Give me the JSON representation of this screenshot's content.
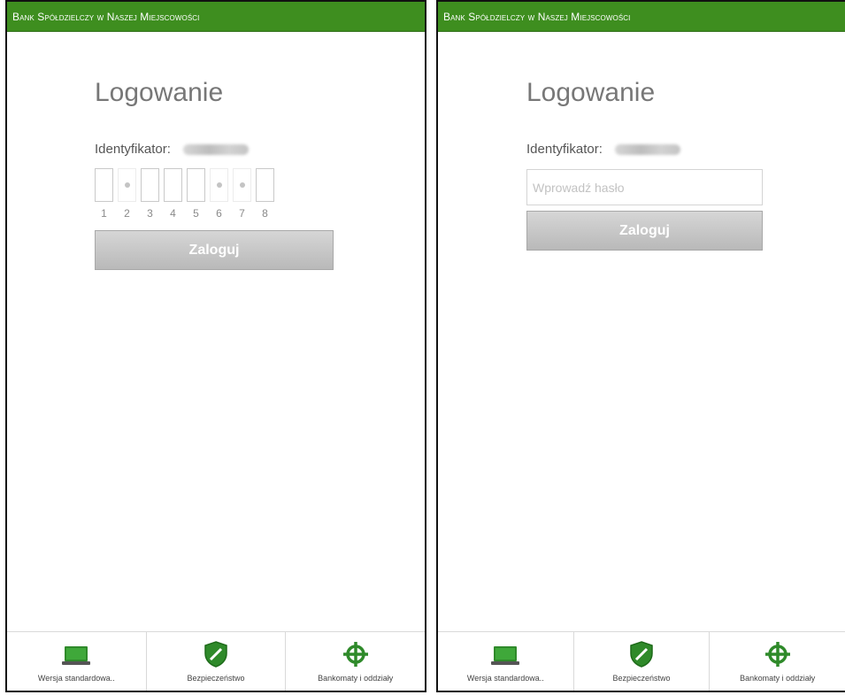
{
  "colors": {
    "brand_green": "#3e8e1f",
    "button_gray": "#c7c7c7",
    "title_gray": "#777777"
  },
  "left": {
    "header": "Bank Spółdzielczy w Naszej Miejscowości",
    "title": "Logowanie",
    "id_label": "Identyfikator:",
    "char_boxes": [
      {
        "num": "1",
        "active": true
      },
      {
        "num": "2",
        "active": false
      },
      {
        "num": "3",
        "active": true
      },
      {
        "num": "4",
        "active": true
      },
      {
        "num": "5",
        "active": true
      },
      {
        "num": "6",
        "active": false
      },
      {
        "num": "7",
        "active": false
      },
      {
        "num": "8",
        "active": true
      }
    ],
    "login_label": "Zaloguj",
    "nav": [
      {
        "label": "Wersja standardowa..",
        "icon": "laptop-icon"
      },
      {
        "label": "Bezpieczeństwo",
        "icon": "shield-icon"
      },
      {
        "label": "Bankomaty i oddziały",
        "icon": "crosshair-icon"
      }
    ]
  },
  "right": {
    "header": "Bank Spółdzielczy w Naszej Miejscowości",
    "title": "Logowanie",
    "id_label": "Identyfikator:",
    "password_placeholder": "Wprowadź hasło",
    "login_label": "Zaloguj",
    "nav": [
      {
        "label": "Wersja standardowa..",
        "icon": "laptop-icon"
      },
      {
        "label": "Bezpieczeństwo",
        "icon": "shield-icon"
      },
      {
        "label": "Bankomaty i oddziały",
        "icon": "crosshair-icon"
      }
    ]
  }
}
